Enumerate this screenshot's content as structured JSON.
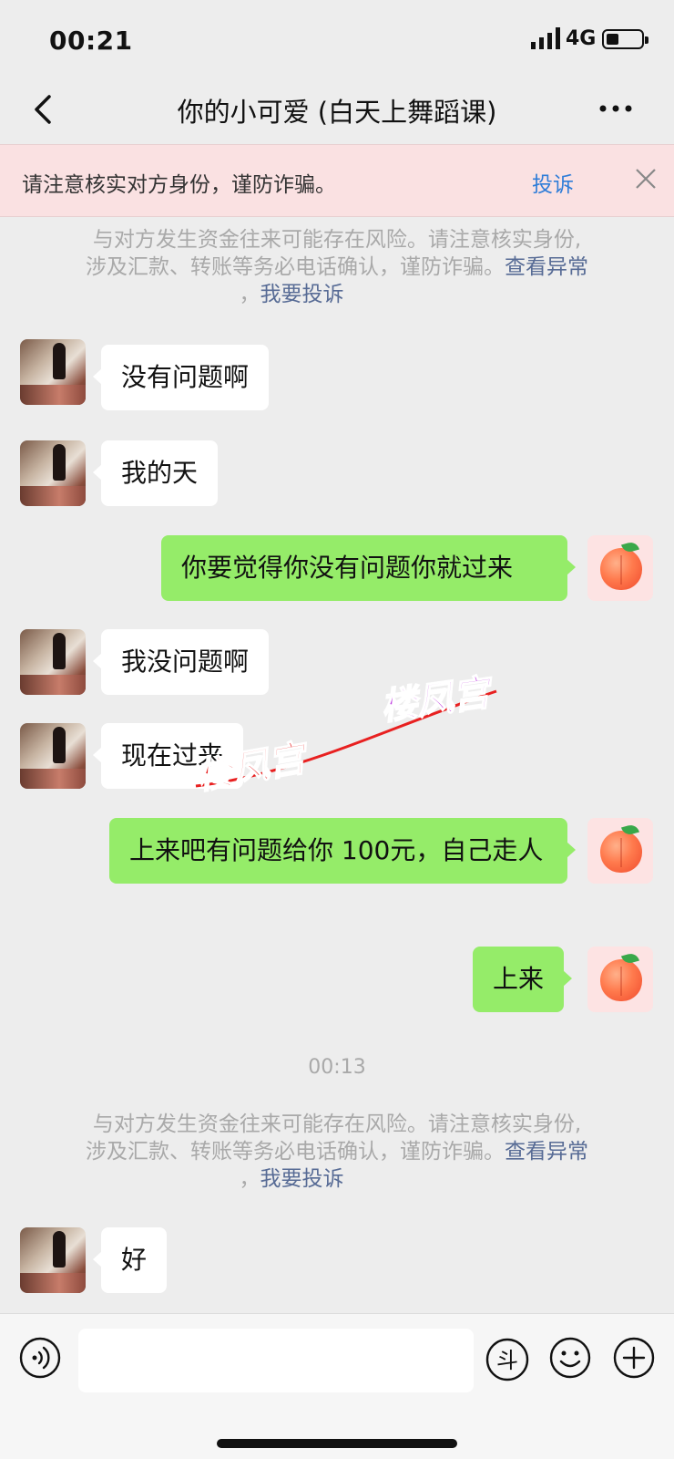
{
  "status_bar": {
    "time": "00:21",
    "network": "4G"
  },
  "nav": {
    "title": "你的小可爱 (白天上舞蹈课)"
  },
  "warning_banner": {
    "text": "请注意核实对方身份，谨防诈骗。",
    "complain_label": "投诉"
  },
  "system_notes": [
    {
      "line1": "与对方发生资金往来可能存在风险。请注意核实身份,",
      "line2_prefix": "涉及汇款、转账等务必电话确认，谨防诈骗。",
      "link_view": "查看异常",
      "line3_prefix": "，",
      "link_report": "我要投诉"
    },
    {
      "line1": "与对方发生资金往来可能存在风险。请注意核实身份,",
      "line2_prefix": "涉及汇款、转账等务必电话确认，谨防诈骗。",
      "link_view": "查看异常",
      "line3_prefix": "，",
      "link_report": "我要投诉"
    }
  ],
  "messages": [
    {
      "side": "left",
      "text": "没有问题啊"
    },
    {
      "side": "left",
      "text": "我的天"
    },
    {
      "side": "right",
      "text": "你要觉得你没有问题你就过来"
    },
    {
      "side": "left",
      "text": "我没问题啊"
    },
    {
      "side": "left",
      "text": "现在过来"
    },
    {
      "side": "right",
      "text": "上来吧有问题给你 100元，自己走人"
    },
    {
      "side": "right",
      "text": "上来"
    },
    {
      "side": "left",
      "text": "好"
    }
  ],
  "timestamp": "00:13",
  "watermark": {
    "text": "楼凤宫",
    "color_top": "#c040e0",
    "color_bottom": "#e82020"
  },
  "colors": {
    "bubble_right": "#95ec69",
    "bubble_left": "#ffffff",
    "link": "#576b95",
    "banner_bg": "#fae1e2",
    "complain": "#2f7dd8"
  },
  "input_bar": {
    "dou_label": "斗"
  }
}
